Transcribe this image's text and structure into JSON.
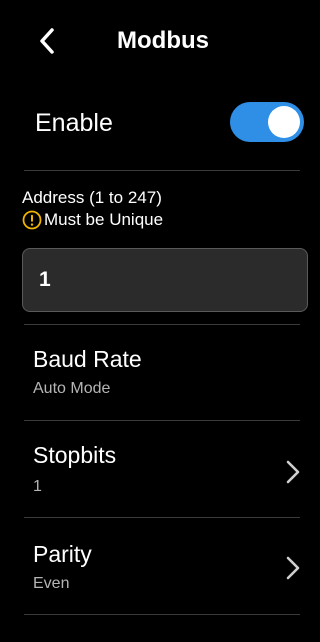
{
  "header": {
    "title": "Modbus",
    "back_icon": "chevron-left-icon"
  },
  "enable": {
    "label": "Enable",
    "state": true,
    "accent_color": "#2f8fe6"
  },
  "address": {
    "label": "Address (1 to 247)",
    "warning_icon": "warning-circle-icon",
    "warning_color": "#f0b400",
    "warning_text": "Must be Unique",
    "value": "1"
  },
  "settings": [
    {
      "title": "Baud Rate",
      "value": "Auto Mode",
      "has_chevron": false
    },
    {
      "title": "Stopbits",
      "value": "1",
      "has_chevron": true
    },
    {
      "title": "Parity",
      "value": "Even",
      "has_chevron": true
    }
  ]
}
